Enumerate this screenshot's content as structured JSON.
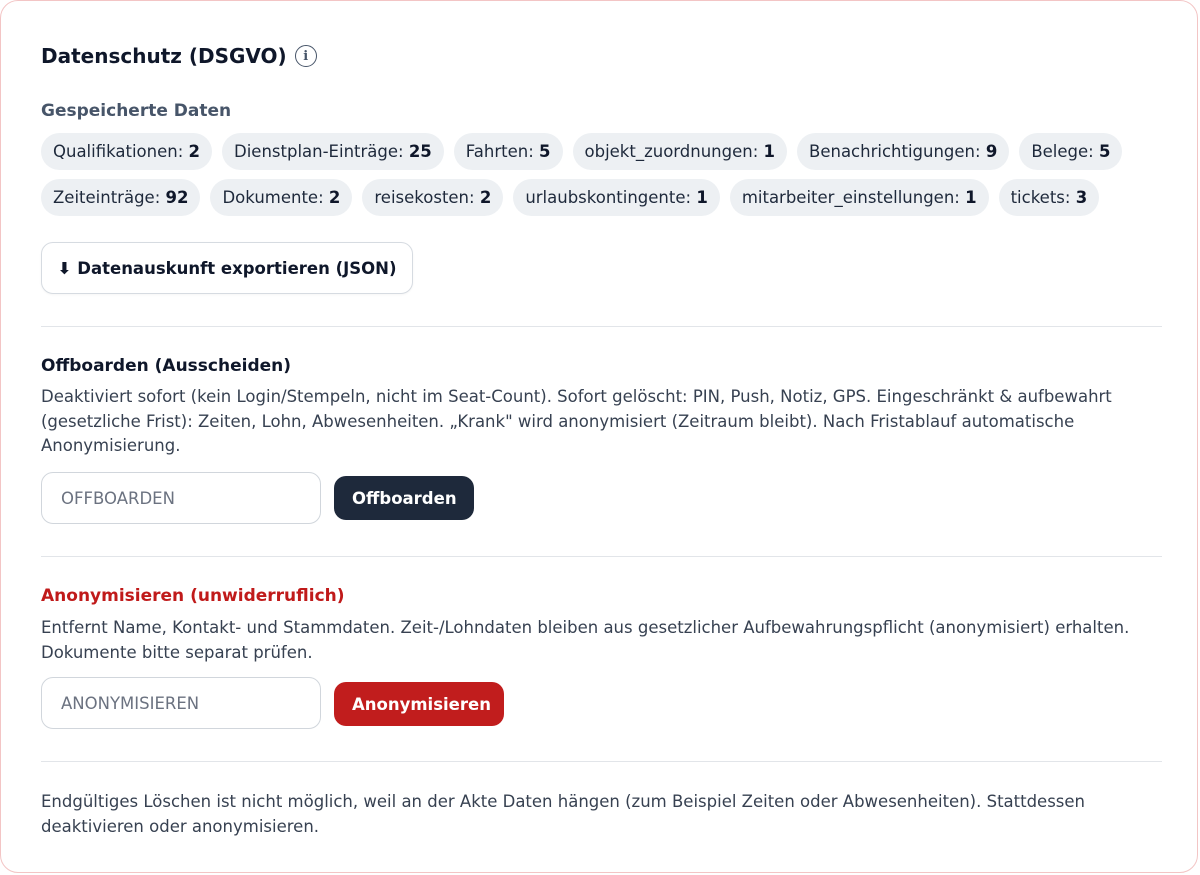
{
  "header": {
    "title": "Datenschutz (DSGVO)",
    "info_icon": "info-icon"
  },
  "stored_data": {
    "heading": "Gespeicherte Daten",
    "row1": [
      {
        "label": "Qualifikationen:",
        "count": "2"
      },
      {
        "label": "Dienstplan-Einträge:",
        "count": "25"
      },
      {
        "label": "Fahrten:",
        "count": "5"
      },
      {
        "label": "objekt_zuordnungen:",
        "count": "1"
      },
      {
        "label": "Benachrichtigungen:",
        "count": "9"
      },
      {
        "label": "Belege:",
        "count": "5"
      }
    ],
    "row2": [
      {
        "label": "Zeiteinträge:",
        "count": "92"
      },
      {
        "label": "Dokumente:",
        "count": "2"
      },
      {
        "label": "reisekosten:",
        "count": "2"
      },
      {
        "label": "urlaubskontingente:",
        "count": "1"
      },
      {
        "label": "mitarbeiter_einstellungen:",
        "count": "1"
      },
      {
        "label": "tickets:",
        "count": "3"
      }
    ],
    "export_icon": "download-arrow-icon",
    "export_label": "Datenauskunft exportieren (JSON)"
  },
  "offboarding": {
    "title": "Offboarden (Ausscheiden)",
    "description": "Deaktiviert sofort (kein Login/Stempeln, nicht im Seat-Count). Sofort gelöscht: PIN, Push, Notiz, GPS. Eingeschränkt & aufbewahrt (gesetzliche Frist): Zeiten, Lohn, Abwesenheiten. „Krank\" wird anonymisiert (Zeitraum bleibt). Nach Fristablauf automatische Anonymisierung.",
    "placeholder": "OFFBOARDEN",
    "value": "",
    "button_label": "Offboarden"
  },
  "anonymize": {
    "title": "Anonymisieren (unwiderruflich)",
    "description": "Entfernt Name, Kontakt- und Stammdaten. Zeit-/Lohndaten bleiben aus gesetzlicher Aufbewahrungspflicht (anonymisiert) erhalten. Dokumente bitte separat prüfen.",
    "placeholder": "ANONYMISIEREN",
    "value": "",
    "button_label": "Anonymisieren"
  },
  "footer": {
    "note": "Endgültiges Löschen ist nicht möglich, weil an der Akte Daten hängen (zum Beispiel Zeiten oder Abwesenheiten). Stattdessen deaktivieren oder anonymisieren."
  },
  "colors": {
    "primary_dark": "#1e293b",
    "danger": "#c11d1d",
    "chip_bg": "#edf0f3",
    "card_border": "#f3c5c5"
  }
}
